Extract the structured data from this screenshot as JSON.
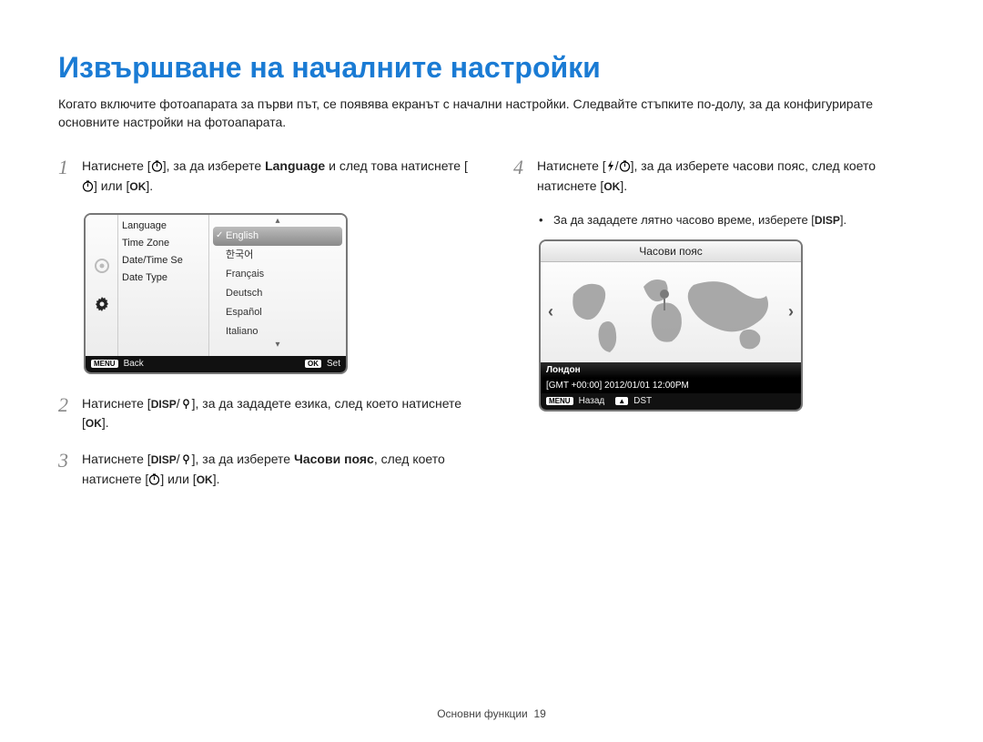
{
  "title": "Извършване на началните настройки",
  "intro": "Когато включите фотоапарата за първи път, се появява екранът с начални настройки. Следвайте стъпките по-долу, за да конфигурирате основните настройки на фотоапарата.",
  "steps": {
    "s1_a": "Натиснете [",
    "s1_b": "], за да изберете ",
    "s1_bold": "Language",
    "s1_c": " и след това натиснете [",
    "s1_d": "] или [",
    "s1_e": "].",
    "s2_a": "Натиснете [",
    "s2_b": "], за да зададете езика, след което натиснете [",
    "s2_c": "].",
    "s3_a": "Натиснете [",
    "s3_b": "], за да изберете ",
    "s3_bold": "Часови пояс",
    "s3_c": ", след което натиснете [",
    "s3_d": "] или [",
    "s3_e": "].",
    "s4_a": "Натиснете [",
    "s4_b": "], за да изберете часови пояс, след което натиснете [",
    "s4_c": "].",
    "s4_bullet_a": "За да зададете лятно часово време, изберете [",
    "s4_bullet_b": "]."
  },
  "iconLabels": {
    "ok": "OK",
    "disp": "DISP"
  },
  "numbers": {
    "n1": "1",
    "n2": "2",
    "n3": "3",
    "n4": "4"
  },
  "lcd1": {
    "menu": [
      "Language",
      "Time Zone",
      "Date/Time Se",
      "Date Type"
    ],
    "langs": [
      "English",
      "한국어",
      "Français",
      "Deutsch",
      "Español",
      "Italiano"
    ],
    "foot_menu": "MENU",
    "foot_back": "Back",
    "foot_ok": "OK",
    "foot_set": "Set"
  },
  "lcd2": {
    "title": "Часови пояс",
    "location": "Лондон",
    "gmt": "[GMT +00:00]   2012/01/01   12:00PM",
    "foot_menu": "MENU",
    "foot_back": "Назад",
    "foot_arrow": "▲",
    "foot_dst": "DST"
  },
  "footer": {
    "section": "Основни функции",
    "page": "19"
  }
}
